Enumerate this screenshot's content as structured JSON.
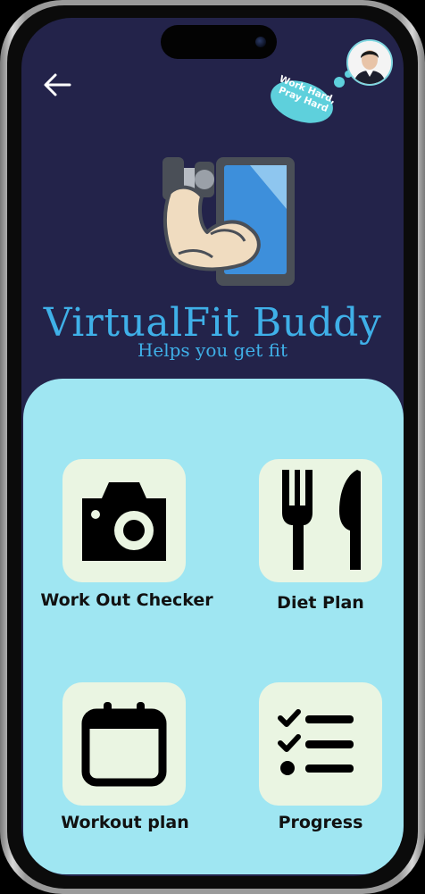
{
  "app": {
    "title": "VirtualFit Buddy",
    "tagline": "Helps you get fit"
  },
  "header": {
    "back_icon": "arrow-left-icon",
    "avatar_icon": "user-avatar",
    "motto_line1": "Work Hard,",
    "motto_line2": "Pray Hard"
  },
  "menu": {
    "items": [
      {
        "label": "Work Out Checker",
        "icon": "camera-icon"
      },
      {
        "label": "Diet Plan",
        "icon": "fork-knife-icon"
      },
      {
        "label": "Workout plan",
        "icon": "calendar-icon"
      },
      {
        "label": "Progress",
        "icon": "checklist-icon"
      }
    ]
  },
  "colors": {
    "screen_bg": "#23234a",
    "panel_bg": "#9fe6f2",
    "card_bg": "#eaf5e2",
    "accent": "#3fb0e8",
    "bubble": "#5ed0dc"
  }
}
